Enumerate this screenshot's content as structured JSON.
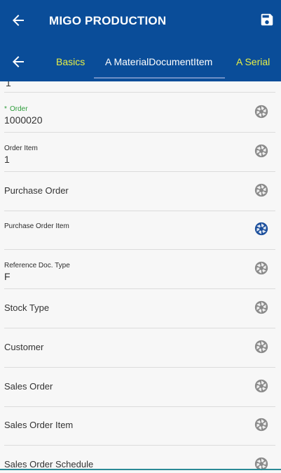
{
  "header": {
    "title": "MIGO PRODUCTION",
    "back_icon": "arrow-left-icon",
    "save_icon": "floppy-disk-icon"
  },
  "tabs": {
    "back_icon": "arrow-left-icon",
    "items": [
      {
        "label": "Basics",
        "active": false
      },
      {
        "label": "A MaterialDocumentItem",
        "active": true
      },
      {
        "label": "A Serial",
        "active": false
      }
    ]
  },
  "form": {
    "partial_value": "1",
    "rows": [
      {
        "label": "Order",
        "required": true,
        "value": "1000020"
      },
      {
        "label": "Order Item",
        "required": false,
        "value": "1"
      },
      {
        "label": "Purchase Order",
        "required": false,
        "value": ""
      },
      {
        "label": "Purchase Order Item",
        "required": false,
        "value": "",
        "lens_active": true
      },
      {
        "label": "Reference Doc. Type",
        "required": false,
        "value": "F"
      },
      {
        "label": "Stock Type",
        "required": false,
        "value": ""
      },
      {
        "label": "Customer",
        "required": false,
        "value": ""
      },
      {
        "label": "Sales Order",
        "required": false,
        "value": ""
      },
      {
        "label": "Sales Order Item",
        "required": false,
        "value": ""
      },
      {
        "label": "Sales Order Schedule",
        "required": false,
        "value": ""
      }
    ]
  },
  "colors": {
    "brand": "#0a4d99",
    "tab_inactive": "#e8ef45",
    "required_label": "#2e9c3b",
    "lens_default": "#8a8a8a",
    "lens_active": "#1c4f9c"
  }
}
